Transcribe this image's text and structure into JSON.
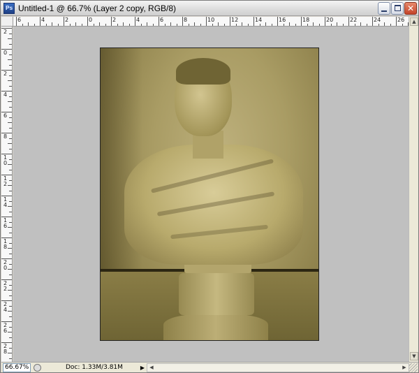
{
  "window": {
    "title": "Untitled-1 @ 66.7% (Layer 2 copy, RGB/8)",
    "app_icon": "Ps",
    "controls": {
      "minimize": "minimize-icon",
      "maximize": "maximize-icon",
      "close": "close-icon"
    }
  },
  "ruler_top": {
    "labels": [
      "6",
      "4",
      "2",
      "0",
      "2",
      "4",
      "6",
      "8",
      "10",
      "12",
      "14",
      "16",
      "18",
      "20",
      "22",
      "24",
      "26"
    ]
  },
  "ruler_left": {
    "labels": [
      "2",
      "0",
      "2",
      "4",
      "6",
      "8",
      "10",
      "12",
      "14",
      "16",
      "18",
      "20",
      "22",
      "24",
      "26",
      "28"
    ]
  },
  "statusbar": {
    "zoom": "66.67%",
    "doc_info": "Doc: 1.33M/3.81M",
    "menu_arrow": "▶"
  },
  "colors": {
    "canvas_bg": "#c0c0c0",
    "photo_tint": "#a99c64"
  }
}
